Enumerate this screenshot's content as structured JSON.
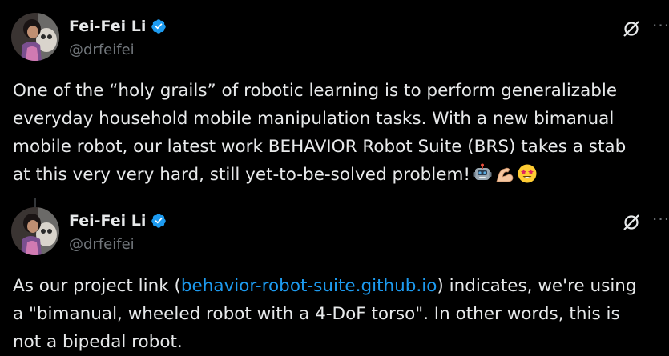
{
  "tweets": [
    {
      "author": {
        "name": "Fei-Fei Li",
        "handle": "@drfeifei",
        "avatar_icon": "avatar-photo",
        "verified_icon": "verified-badge-icon"
      },
      "actions": {
        "grok_icon": "grok-icon",
        "more_label": "···"
      },
      "text_lines": [
        "One of the “holy grails” of robotic learning is to perform generalizable",
        "everyday household mobile manipulation tasks. With a new bimanual",
        "mobile robot, our latest work BEHAVIOR Robot Suite (BRS) takes a stab",
        "at this very very hard, still yet-to-be-solved problem!"
      ],
      "emojis": [
        "robot-face-emoji",
        "flexed-biceps-emoji",
        "star-struck-emoji"
      ]
    },
    {
      "author": {
        "name": "Fei-Fei Li",
        "handle": "@drfeifei",
        "avatar_icon": "avatar-photo",
        "verified_icon": "verified-badge-icon"
      },
      "actions": {
        "grok_icon": "grok-icon",
        "more_label": "···"
      },
      "text": {
        "line1_prefix": "As our project link (",
        "line1_link": "behavior-robot-suite.github.io",
        "line1_suffix": ") indicates, we're using",
        "line2": "a \"bimanual, wheeled robot with a 4-DoF torso\". In other words, this is",
        "line3": "not a bipedal robot."
      }
    }
  ],
  "colors": {
    "background": "#000000",
    "text": "#e7e9ea",
    "secondary": "#71767b",
    "link": "#1d9bf0",
    "verified": "#1d9bf0"
  }
}
